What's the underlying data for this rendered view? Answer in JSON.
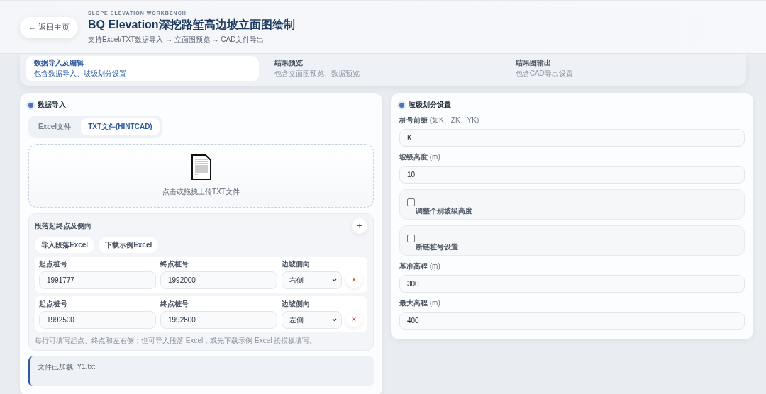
{
  "header": {
    "back_button": "← 返回主页",
    "eyebrow": "SLOPE ELEVATION WORKBENCH",
    "title": "BQ Elevation深挖路堑高边坡立面图绘制",
    "subtitle": "支持Excel/TXT数据导入 → 立面图预览 → CAD文件导出"
  },
  "steps": [
    {
      "title": "数据导入及编辑",
      "description": "包含数据导入、坡级划分设置",
      "selected": true
    },
    {
      "title": "结果预览",
      "description": "包含立面图预览、数据预览",
      "selected": false
    },
    {
      "title": "结果图输出",
      "description": "包含CAD导出设置",
      "selected": false
    }
  ],
  "import_panel": {
    "title": "数据导入",
    "tabs": [
      {
        "label": "Excel文件",
        "selected": false
      },
      {
        "label": "TXT文件(HINTCAD)",
        "selected": true
      }
    ],
    "dropzone": {
      "text": "点击或拖拽上传TXT文件"
    },
    "segments": {
      "title": "段落起终点及侧向",
      "add_button": "+",
      "buttons": [
        "导入段落Excel",
        "下载示例Excel"
      ],
      "rows": [
        {
          "start_label": "起点桩号",
          "start": "1991777",
          "end_label": "终点桩号",
          "end": "1992000",
          "side_label": "边坡侧向",
          "side": "右侧",
          "remove_button": "×"
        },
        {
          "start_label": "起点桩号",
          "start": "1992500",
          "end_label": "终点桩号",
          "end": "1992800",
          "side_label": "边坡侧向",
          "side": "左侧",
          "remove_button": "×"
        }
      ],
      "hint": "每行可填写起点、终点和左右侧；也可导入段落 Excel，或先下载示例 Excel 按模板填写。"
    },
    "file_info": "文件已加载: Y1.txt"
  },
  "settings_panel": {
    "title": "坡级划分设置",
    "fields": [
      {
        "kind": "input",
        "label": "**桩号前缀** (如K、ZK、YK)",
        "value": "K"
      },
      {
        "kind": "input",
        "label": "**坡级高度** (m)",
        "value": "10"
      },
      {
        "kind": "checkbox",
        "label": "调整个别坡级高度",
        "checked": false
      },
      {
        "kind": "checkbox",
        "label": "断链桩号设置",
        "checked": false
      },
      {
        "kind": "input",
        "label": "**基准高程** (m)",
        "value": "300"
      },
      {
        "kind": "input",
        "label": "**最大高程** (m)",
        "value": "400"
      }
    ]
  }
}
